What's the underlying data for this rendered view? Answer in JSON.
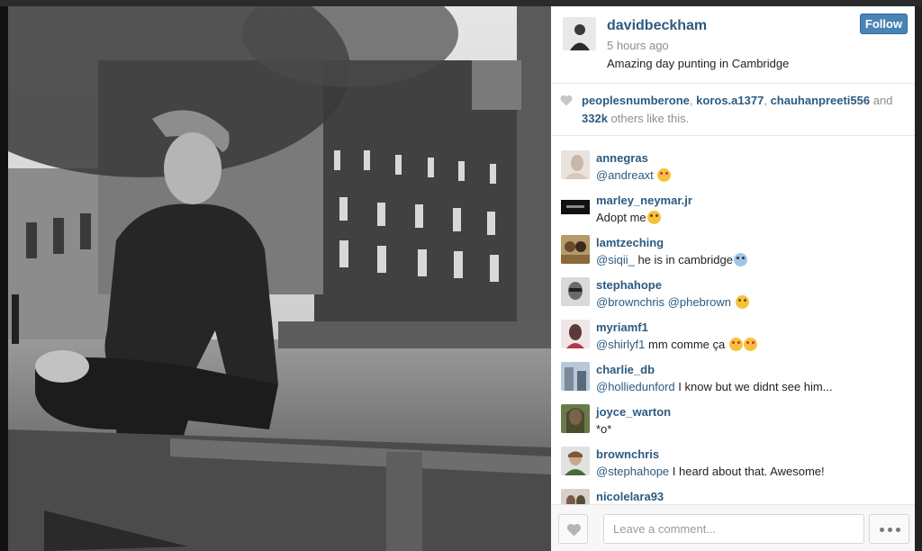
{
  "post": {
    "author": "davidbeckham",
    "time": "5 hours ago",
    "caption": "Amazing day punting in Cambridge",
    "follow_label": "Follow"
  },
  "likes": {
    "users": [
      "peoplesnumberone",
      "koros.a1377",
      "chauhanpreeti556"
    ],
    "and_text": " and",
    "count": "332k",
    "suffix": " others like this."
  },
  "comments": [
    {
      "user": "annegras",
      "mention": "@andreaxt",
      "text": "",
      "emoji": [
        "heart-eyes"
      ]
    },
    {
      "user": "marley_neymar.jr",
      "mention": "",
      "text": "Adopt me",
      "emoji": [
        "pleading"
      ]
    },
    {
      "user": "lamtzeching",
      "mention": "@siqii_",
      "text": " he is in cambridge",
      "emoji": [
        "scream"
      ]
    },
    {
      "user": "stephahope",
      "mention": "@brownchris @phebrown",
      "text": "",
      "emoji": [
        "smile"
      ]
    },
    {
      "user": "myriamf1",
      "mention": "@shirlyf1",
      "text": " mm comme ça",
      "emoji": [
        "heart-eyes",
        "heart-eyes"
      ]
    },
    {
      "user": "charlie_db",
      "mention": "@holliedunford",
      "text": " I know but we didnt see him...",
      "emoji": []
    },
    {
      "user": "joyce_warton",
      "mention": "",
      "text": "*o*",
      "emoji": []
    },
    {
      "user": "brownchris",
      "mention": "@stephahope",
      "text": " I heard about that. Awesome!",
      "emoji": []
    },
    {
      "user": "nicolelara93",
      "mention": "",
      "text": "",
      "emoji": []
    }
  ],
  "comment_bar": {
    "placeholder": "Leave a comment..."
  },
  "colors": {
    "link": "#2d5a80",
    "follow_button": "#4a83b5",
    "muted": "#8e8e8e"
  }
}
